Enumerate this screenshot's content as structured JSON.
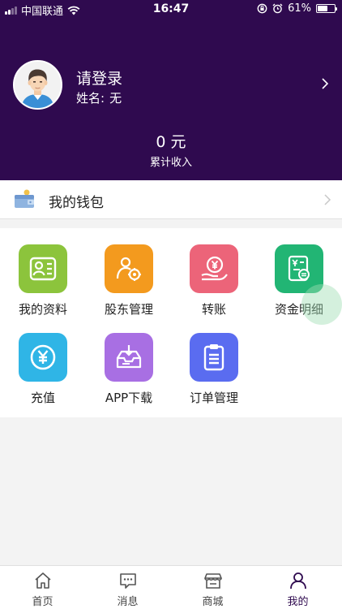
{
  "status_bar": {
    "carrier": "中国联通",
    "time": "16:47",
    "battery": "61%"
  },
  "profile": {
    "login_title": "请登录",
    "name_label": "姓名:",
    "name_value": "无"
  },
  "income": {
    "value": "0 元",
    "label": "累计收入"
  },
  "wallet": {
    "label": "我的钱包"
  },
  "grid": {
    "items": [
      {
        "label": "我的资料",
        "color": "#8cc43c"
      },
      {
        "label": "股东管理",
        "color": "#f39a1e"
      },
      {
        "label": "转账",
        "color": "#ec6479"
      },
      {
        "label": "资金明细",
        "color": "#22b574"
      },
      {
        "label": "充值",
        "color": "#2fb5e6"
      },
      {
        "label": "APP下载",
        "color": "#a86fe3"
      },
      {
        "label": "订单管理",
        "color": "#5a6cf0"
      }
    ]
  },
  "tabbar": {
    "items": [
      {
        "label": "首页",
        "icon": "home-icon"
      },
      {
        "label": "消息",
        "icon": "message-icon"
      },
      {
        "label": "商城",
        "icon": "store-icon"
      },
      {
        "label": "我的",
        "icon": "user-icon"
      }
    ],
    "active_index": 3
  },
  "colors": {
    "header_bg": "#2f0a4f",
    "accent": "#2f0a4f"
  }
}
